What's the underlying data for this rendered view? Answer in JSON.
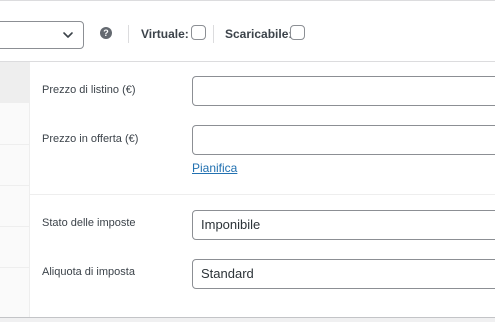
{
  "header": {
    "help_glyph": "?",
    "virtual_label": "Virtuale:",
    "downloadable_label": "Scaricabile:"
  },
  "pricing": {
    "regular_price_label": "Prezzo di listino (€)",
    "regular_price_value": "",
    "sale_price_label": "Prezzo in offerta (€)",
    "sale_price_value": "",
    "schedule_link": "Pianifica"
  },
  "tax": {
    "status_label": "Stato delle imposte",
    "status_value": "Imponibile",
    "class_label": "Aliquota di imposta",
    "class_value": "Standard"
  },
  "icons": {
    "help": "help-icon",
    "dropdown": "chevron-down-icon"
  },
  "colors": {
    "link": "#2271b1",
    "border": "#8c8f94",
    "help_icon_bg": "#646970"
  }
}
